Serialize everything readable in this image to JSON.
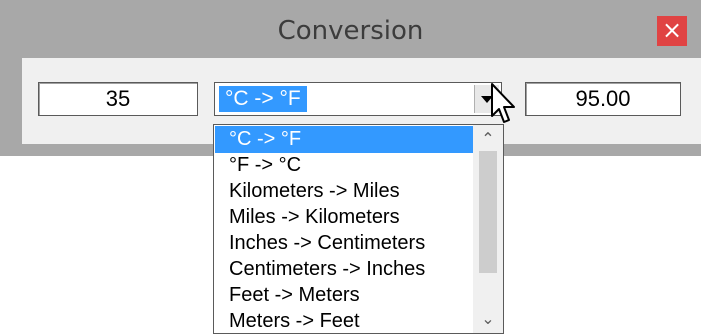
{
  "window": {
    "title": "Conversion",
    "close_label": "×"
  },
  "converter": {
    "input_value": "35",
    "selected_conversion": "°C -> °F",
    "output_value": "95.00"
  },
  "dropdown": {
    "options": [
      {
        "label": "°C -> °F",
        "selected": true
      },
      {
        "label": "°F -> °C",
        "selected": false
      },
      {
        "label": "Kilometers -> Miles",
        "selected": false
      },
      {
        "label": "Miles -> Kilometers",
        "selected": false
      },
      {
        "label": "Inches -> Centimeters",
        "selected": false
      },
      {
        "label": "Centimeters -> Inches",
        "selected": false
      },
      {
        "label": "Feet -> Meters",
        "selected": false
      },
      {
        "label": "Meters -> Feet",
        "selected": false
      }
    ]
  },
  "icons": {
    "scroll_up": "chevron-up-icon",
    "scroll_down": "chevron-down-icon",
    "close": "close-icon",
    "cursor": "mouse-pointer-icon"
  },
  "colors": {
    "selection": "#3399ff",
    "close_button": "#e04343",
    "window_frame": "#a8a8a8"
  }
}
